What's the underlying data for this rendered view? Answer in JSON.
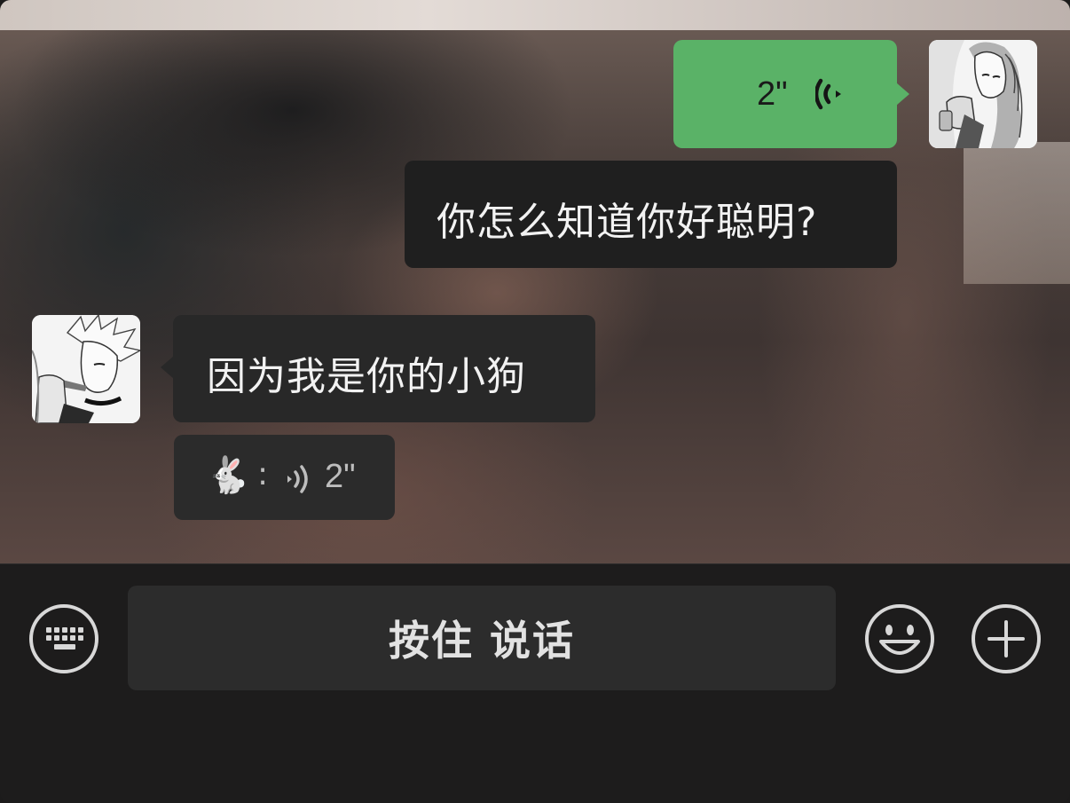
{
  "messages": {
    "outgoing_voice": {
      "duration": "2\""
    },
    "outgoing_text": "你怎么知道你好聪明?",
    "incoming_text": "因为我是你的小狗",
    "quoted_voice": {
      "emoji": "🐇",
      "separator": ":",
      "duration": "2\""
    }
  },
  "toolbar": {
    "hold_to_talk_label": "按住 说话",
    "left_icon": "keyboard-icon",
    "emoji_icon": "smiley-icon",
    "more_icon": "plus-icon"
  },
  "colors": {
    "outgoing_bubble": "#5ab267",
    "dark_bubble": "#282828",
    "toolbar_bg": "#1d1c1c"
  }
}
